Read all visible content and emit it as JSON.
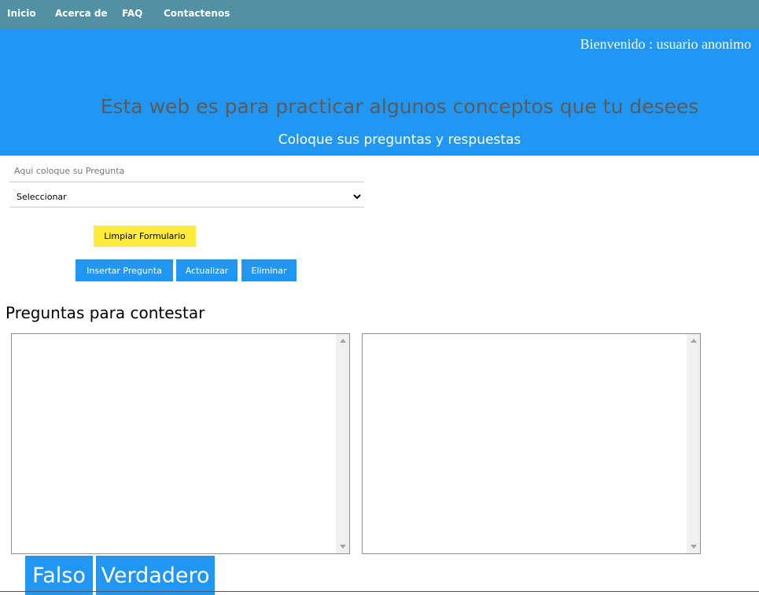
{
  "nav": {
    "items": [
      {
        "label": "Inicio"
      },
      {
        "label": "Acerca de"
      },
      {
        "label": "FAQ"
      },
      {
        "label": "Contactenos"
      }
    ]
  },
  "header": {
    "welcome": "Bienvenido : usuario anonimo",
    "title": "Esta web es para practicar algunos conceptos que tu desees",
    "subtitle": "Coloque sus preguntas y respuestas"
  },
  "form": {
    "question_placeholder": "Aqui coloque su Pregunta",
    "question_value": "",
    "select_value": "Seleccionar",
    "clear_label": "Limpiar Formulario",
    "insert_label": "Insertar Pregunta",
    "update_label": "Actualizar",
    "delete_label": "Eliminar"
  },
  "questions": {
    "title": "Preguntas para contestar",
    "false_label": "Falso",
    "true_label": "Verdadero"
  },
  "colors": {
    "nav_bg": "#5291a3",
    "hero_bg": "#2196f3",
    "accent_blue": "#2196f3",
    "accent_yellow": "#ffeb3b"
  }
}
